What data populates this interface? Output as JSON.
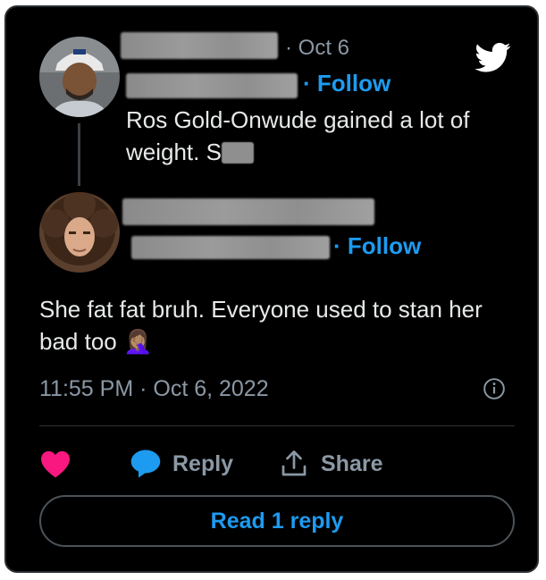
{
  "parent_tweet": {
    "timestamp": "· Oct 6",
    "follow_label": "· Follow",
    "text_line1": "Ros Gold-Onwude gained a lot of",
    "text_line2": "weight. S"
  },
  "reply_tweet": {
    "follow_label": "· Follow",
    "text_line1": "She fat fat bruh. Everyone used to stan her",
    "text_line2": "bad too",
    "emoji": "🤦🏽‍♀️",
    "timestamp": "11:55 PM · Oct 6, 2022"
  },
  "actions": {
    "reply_label": "Reply",
    "share_label": "Share",
    "read_replies_label": "Read 1 reply"
  },
  "icons": {
    "brand": "twitter-bird-icon",
    "like": "heart-icon",
    "reply": "speech-bubble-icon",
    "share": "share-upload-icon",
    "info": "info-icon"
  },
  "colors": {
    "background": "#000000",
    "accent": "#1d9bf0",
    "like": "#f91880",
    "muted": "#8b98a5",
    "text": "#e7e9ea"
  }
}
